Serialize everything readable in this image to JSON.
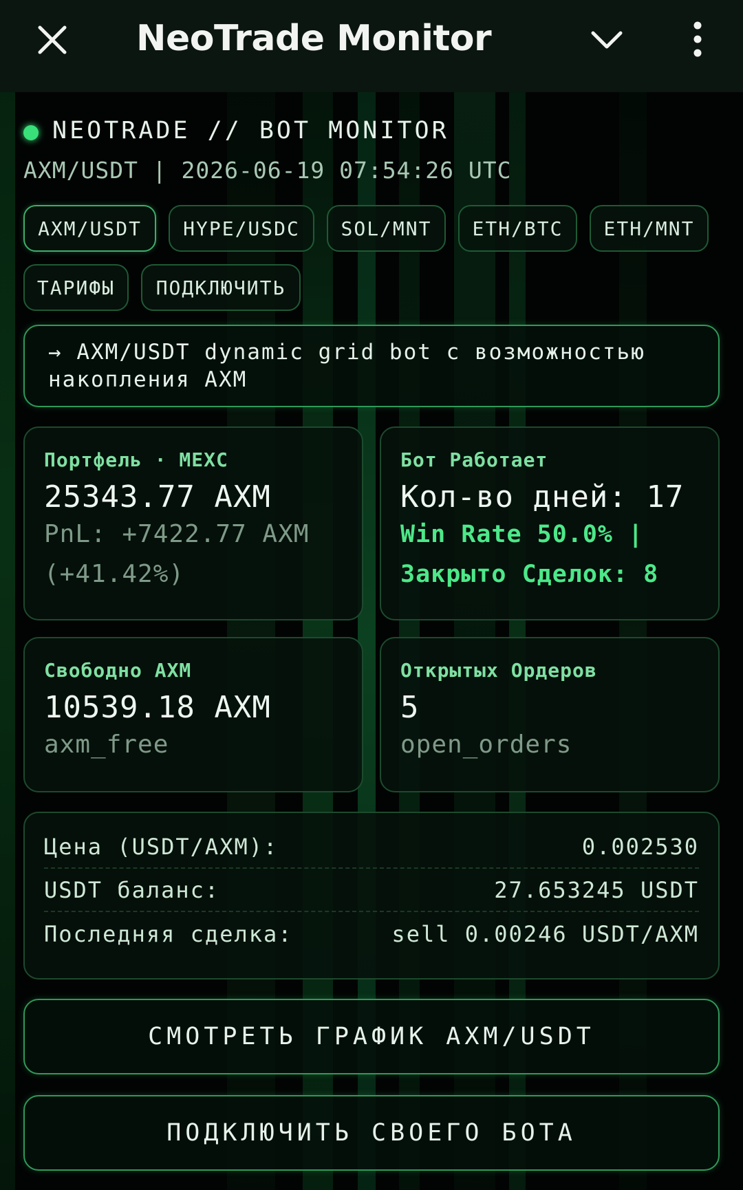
{
  "appbar": {
    "title": "NeoTrade Monitor",
    "close_icon": "close-icon",
    "chevron_icon": "chevron-down-icon",
    "menu_icon": "more-vertical-icon"
  },
  "header": {
    "title": "NEOTRADE // BOT MONITOR",
    "subtitle": "AXM/USDT | 2026-06-19 07:54:26 UTC",
    "status_color": "#39e07a"
  },
  "chips": [
    {
      "label": "AXM/USDT",
      "active": true
    },
    {
      "label": "HYPE/USDC",
      "active": false
    },
    {
      "label": "SOL/MNT",
      "active": false
    },
    {
      "label": "ETH/BTC",
      "active": false
    },
    {
      "label": "ETH/MNT",
      "active": false
    },
    {
      "label": "ТАРИФЫ",
      "active": false
    },
    {
      "label": "ПОДКЛЮЧИТЬ",
      "active": false
    }
  ],
  "description": "→ AXM/USDT dynamic grid bot с возможностью накопления AXM",
  "cards": {
    "portfolio": {
      "label": "Портфель · MEXC",
      "value": "25343.77 AXM",
      "pnl_line1": "PnL: +7422.77 AXM",
      "pnl_line2": "(+41.42%)"
    },
    "bot": {
      "label": "Бот Работает",
      "value": "Кол-во дней: 17",
      "line1": "Win Rate 50.0% |",
      "line2": "Закрыто Сделок: 8"
    },
    "free": {
      "label": "Свободно AXM",
      "value": "10539.18 AXM",
      "sub": "axm_free"
    },
    "orders": {
      "label": "Открытых Ордеров",
      "value": "5",
      "sub": "open_orders"
    }
  },
  "info": [
    {
      "key": "Цена (USDT/AXM):",
      "value": "0.002530"
    },
    {
      "key": "USDT баланс:",
      "value": "27.653245 USDT"
    },
    {
      "key": "Последняя сделка:",
      "value": "sell 0.00246 USDT/AXM"
    }
  ],
  "buttons": {
    "chart": "СМОТРЕТЬ ГРАФИК AXM/USDT",
    "connect": "ПОДКЛЮЧИТЬ СВОЕГО БОТА"
  },
  "colors": {
    "accent": "#4de889",
    "border": "#2f9a58",
    "background": "#020403"
  }
}
